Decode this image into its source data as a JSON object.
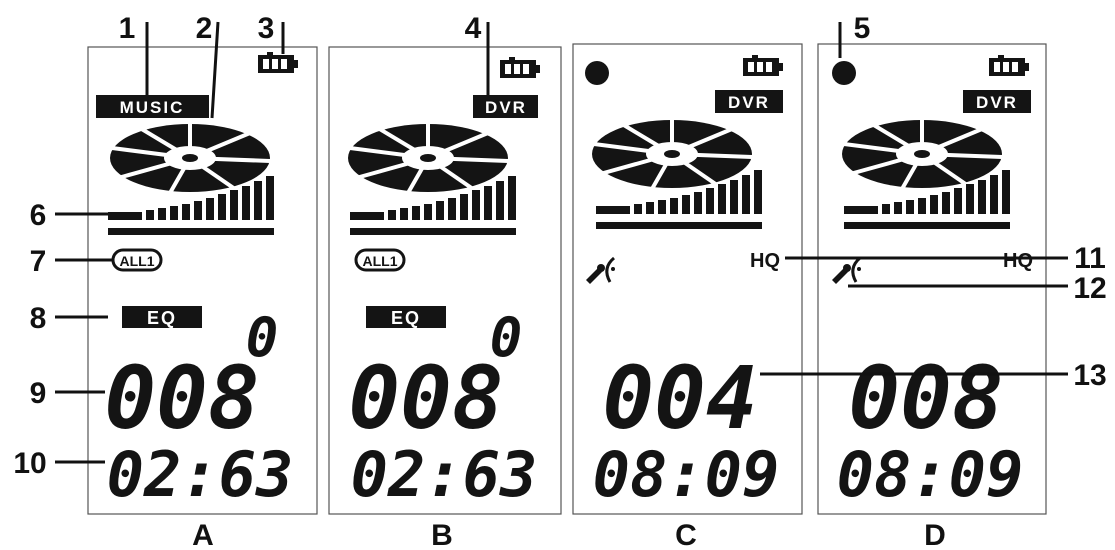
{
  "panels": [
    {
      "id": "A",
      "mode_tag": "MUSIC",
      "repeat_icon": "ALL1",
      "eq_tag": "EQ",
      "eq_value": "0",
      "track": "008",
      "time": "02:63",
      "rec_dot": false,
      "hq": "",
      "mic_icon": false,
      "caption": "A"
    },
    {
      "id": "B",
      "mode_tag": "DVR",
      "repeat_icon": "ALL1",
      "eq_tag": "EQ",
      "eq_value": "0",
      "track": "008",
      "time": "02:63",
      "rec_dot": false,
      "hq": "",
      "mic_icon": false,
      "caption": "B"
    },
    {
      "id": "C",
      "mode_tag": "DVR",
      "repeat_icon": "",
      "eq_tag": "",
      "eq_value": "",
      "track": "004",
      "time": "08:09",
      "rec_dot": true,
      "hq": "HQ",
      "mic_icon": true,
      "caption": "C"
    },
    {
      "id": "D",
      "mode_tag": "DVR",
      "repeat_icon": "",
      "eq_tag": "",
      "eq_value": "",
      "track": "008",
      "time": "08:09",
      "rec_dot": true,
      "hq": "HQ",
      "mic_icon": true,
      "caption": "D"
    }
  ],
  "callouts": {
    "c1": "1",
    "c2": "2",
    "c3": "3",
    "c4": "4",
    "c5": "5",
    "c6": "6",
    "c7": "7",
    "c8": "8",
    "c9": "9",
    "c10": "10",
    "c11": "11",
    "c12": "12",
    "c13": "13"
  },
  "icons": {
    "battery": "battery-icon",
    "disc": "disc-icon",
    "level_bars": "level-meter-icon",
    "mic": "voice-recording-icon",
    "record": "record-dot-icon"
  },
  "colors": {
    "lcd_ink": "#141414",
    "background": "#ffffff",
    "panel_border": "#555555"
  }
}
